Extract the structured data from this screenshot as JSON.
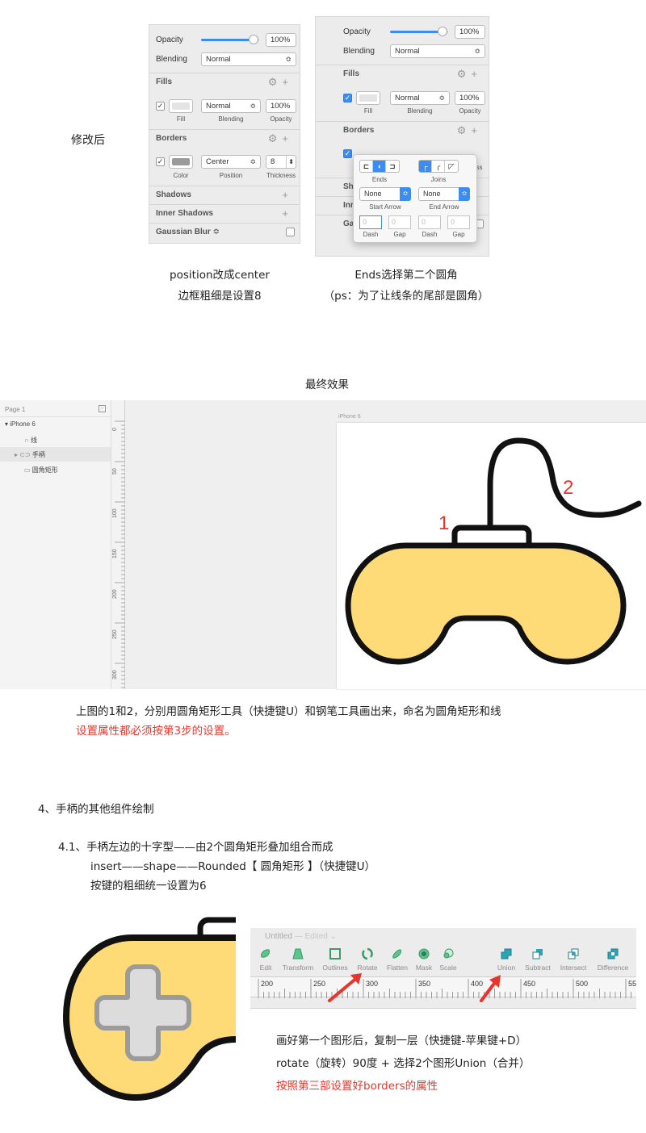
{
  "colors": {
    "accent": "#3b8df2",
    "red_text": "#e8352b",
    "pad_fill": "#fedb77",
    "stroke": "#111111",
    "cross_fill": "#dcdcdc",
    "cross_stroke": "#9b9b9b",
    "annot": "#e8352b"
  },
  "left_label": "修改后",
  "panel1": {
    "opacity_label": "Opacity",
    "opacity_value": "100%",
    "opacity_level": 0.9,
    "blending_label": "Blending",
    "blending_value": "Normal",
    "fills": {
      "title": "Fills",
      "blend": "Normal",
      "opacity": "100%",
      "sub_fill": "Fill",
      "sub_blending": "Blending",
      "sub_opacity": "Opacity",
      "swatch": "#e4e4e4"
    },
    "borders": {
      "title": "Borders",
      "position": "Center",
      "thickness": "8",
      "sub_color": "Color",
      "sub_position": "Position",
      "sub_thickness": "Thickness",
      "swatch": "#9a9a9a"
    },
    "shadows": "Shadows",
    "inner_shadows": "Inner Shadows",
    "gaussian_blur": "Gaussian Blur ≎"
  },
  "panel2": {
    "opacity_label": "Opacity",
    "opacity_value": "100%",
    "opacity_level": 0.9,
    "blending_label": "Blending",
    "blending_value": "Normal",
    "fills": {
      "title": "Fills",
      "blend": "Normal",
      "opacity": "100%",
      "sub_fill": "Fill",
      "sub_blending": "Blending",
      "sub_opacity": "Opacity"
    },
    "borders": {
      "title": "Borders"
    },
    "partial_rows": [
      "Sh",
      "Inn",
      "Ga"
    ],
    "partial_right": "ess",
    "popover": {
      "ends_label": "Ends",
      "joins_label": "Joins",
      "start_arrow_label": "Start Arrow",
      "end_arrow_label": "End Arrow",
      "start_arrow": "None",
      "end_arrow": "None",
      "dash_label": "Dash",
      "gap_label": "Gap",
      "dash_values": [
        "0",
        "0",
        "0",
        "0"
      ]
    }
  },
  "caption1": {
    "line1": "position改成center",
    "line2": "边框粗细是设置8"
  },
  "caption2": {
    "line1": "Ends选择第二个圆角",
    "line2": "（ps：为了让线条的尾部是圆角）"
  },
  "final_title": "最终效果",
  "sketch": {
    "page": "Page 1",
    "artboard_layer": "iPhone 6",
    "layers": [
      "线",
      "手柄",
      "圆角矩形"
    ],
    "artboard_label": "iPhone 6",
    "ruler_ticks": [
      "0",
      "50",
      "100",
      "150",
      "200",
      "250",
      "300"
    ],
    "annot_1": "1",
    "annot_2": "2"
  },
  "para1": {
    "line1": "上图的1和2，分别用圆角矩形工具（快捷键U）和钢笔工具画出来，命名为圆角矩形和线",
    "line2": "设置属性都必须按第3步的设置。"
  },
  "section4": "4、手柄的其他组件绘制",
  "s41": {
    "line1": "4.1、手柄左边的十字型——由2个圆角矩形叠加组合而成",
    "line2": "insert——shape——Rounded【 圆角矩形 】（快捷键U）",
    "line3": "按键的粗细统一设置为6"
  },
  "toolbar": {
    "title": "Untitled",
    "edited": "— Edited ⌄",
    "tools": [
      "Edit",
      "Transform",
      "Outlines",
      "Rotate",
      "Flatten",
      "Mask",
      "Scale"
    ],
    "bool_tools": [
      "Union",
      "Subtract",
      "Intersect",
      "Difference"
    ],
    "ruler": [
      "200",
      "250",
      "300",
      "350",
      "400",
      "450",
      "500",
      "55"
    ]
  },
  "bottom": {
    "line1": "画好第一个图形后，复制一层（快捷键-苹果键+D）",
    "line2": "rotate（旋转）90度  +   选择2个图形Union（合并）",
    "line3": "按照第三部设置好borders的属性"
  }
}
